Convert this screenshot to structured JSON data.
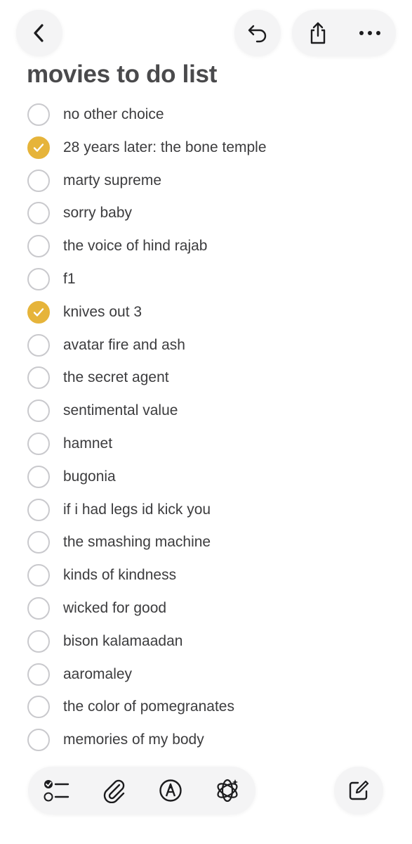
{
  "note": {
    "title": "movies to do list",
    "items": [
      {
        "text": "no other choice",
        "checked": false
      },
      {
        "text": "28 years later: the bone temple",
        "checked": true
      },
      {
        "text": "marty supreme",
        "checked": false
      },
      {
        "text": "sorry baby",
        "checked": false
      },
      {
        "text": "the voice of hind rajab",
        "checked": false
      },
      {
        "text": "f1",
        "checked": false
      },
      {
        "text": "knives out 3",
        "checked": true
      },
      {
        "text": "avatar fire and ash",
        "checked": false
      },
      {
        "text": "the secret agent",
        "checked": false
      },
      {
        "text": "sentimental value",
        "checked": false
      },
      {
        "text": "hamnet",
        "checked": false
      },
      {
        "text": "bugonia",
        "checked": false
      },
      {
        "text": "if i had legs id kick you",
        "checked": false
      },
      {
        "text": "the smashing machine",
        "checked": false
      },
      {
        "text": "kinds of kindness",
        "checked": false
      },
      {
        "text": "wicked for good",
        "checked": false
      },
      {
        "text": "bison kalamaadan",
        "checked": false
      },
      {
        "text": "aaromaley",
        "checked": false
      },
      {
        "text": "the color of pomegranates",
        "checked": false
      },
      {
        "text": "memories of my body",
        "checked": false
      }
    ]
  },
  "header": {
    "icons": [
      "chevron-left-icon",
      "undo-icon",
      "share-icon",
      "more-icon"
    ]
  },
  "toolbar": {
    "icons": [
      "checklist-icon",
      "paperclip-icon",
      "markup-icon",
      "apple-intelligence-icon",
      "compose-icon"
    ]
  },
  "colors": {
    "accent": "#e6b43a",
    "unchecked_border": "#c9c9cd",
    "text": "#3c3c3e",
    "pill_background": "#f4f4f5"
  }
}
